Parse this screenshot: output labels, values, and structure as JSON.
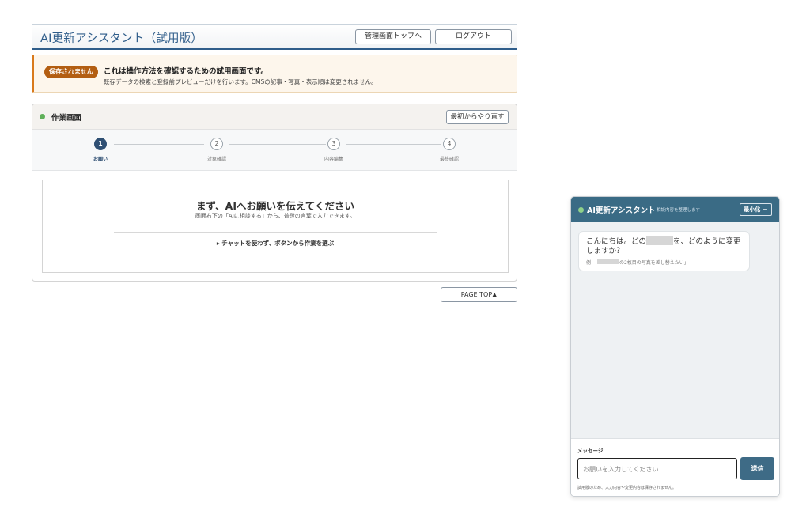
{
  "header": {
    "title": "AI更新アシスタント（試用版）",
    "admin_top_label": "管理画面トップへ",
    "logout_label": "ログアウト"
  },
  "notice": {
    "badge": "保存されません",
    "title": "これは操作方法を確認するための試用画面です。",
    "description": "既存データの検索と登録前プレビューだけを行います。CMSの記事・写真・表示順は変更されません。"
  },
  "work_panel": {
    "title": "作業画面",
    "restart_label": "最初からやり直す",
    "steps": [
      {
        "number": "1",
        "label": "お願い",
        "active": true
      },
      {
        "number": "2",
        "label": "対象確認",
        "active": false
      },
      {
        "number": "3",
        "label": "内容編集",
        "active": false
      },
      {
        "number": "4",
        "label": "最終確認",
        "active": false
      }
    ],
    "heading": "まず、AIへお願いを伝えてください",
    "subtext": "画面右下の「AIに相談する」から、普段の言葉で入力できます。",
    "manual_link": "▸ チャットを使わず、ボタンから作業を選ぶ"
  },
  "page_top_label": "PAGE TOP▲",
  "chat": {
    "title": "AI更新アシスタント",
    "subtitle": "相談内容を整理します",
    "minimize_label": "最小化 －",
    "greeting_prefix": "こんにちは。どの",
    "greeting_suffix": "を、どのように変更しますか？",
    "example_prefix": "例：",
    "example_suffix": "の2枚目の写真を差し替えたい」",
    "message_label": "メッセージ",
    "input_placeholder": "お願いを入力してください",
    "send_label": "送信",
    "footer_note": "試用版のため、入力内容や変更内容は保存されません。"
  },
  "colors": {
    "accent": "#2f5d8a",
    "chat_header": "#3a6b85",
    "badge": "#b35e12",
    "status_dot": "#5fb05a"
  }
}
